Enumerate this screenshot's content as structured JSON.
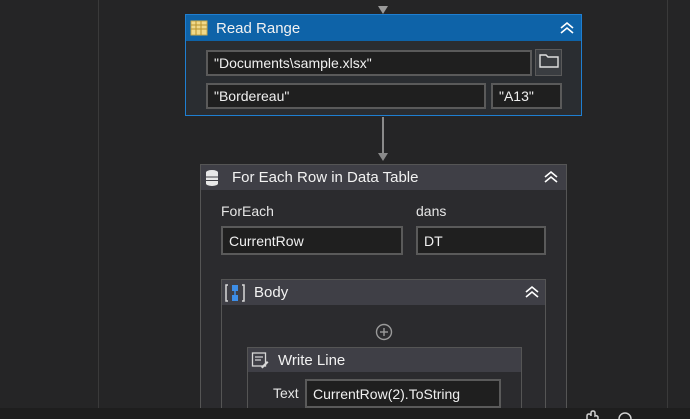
{
  "read_range": {
    "title": "Read Range",
    "workbook_path": "\"Documents\\sample.xlsx\"",
    "sheet_name": "\"Bordereau\"",
    "range": "\"A13\"",
    "icon": "spreadsheet-icon"
  },
  "for_each_row": {
    "title": "For Each Row in Data Table",
    "foreach_label": "ForEach",
    "in_label": "dans",
    "item_value": "CurrentRow",
    "datatable_value": "DT",
    "icon": "data-table-icon"
  },
  "body": {
    "title": "Body",
    "icon": "sequence-icon"
  },
  "write_line": {
    "title": "Write Line",
    "text_label": "Text",
    "text_value": "CurrentRow(2).ToString",
    "icon": "write-line-icon"
  },
  "colors": {
    "selected_header": "#0e63a8",
    "selected_border": "#1f7fd1",
    "canvas": "#252526",
    "panel": "#2d2d30",
    "header": "#3e3e42"
  }
}
